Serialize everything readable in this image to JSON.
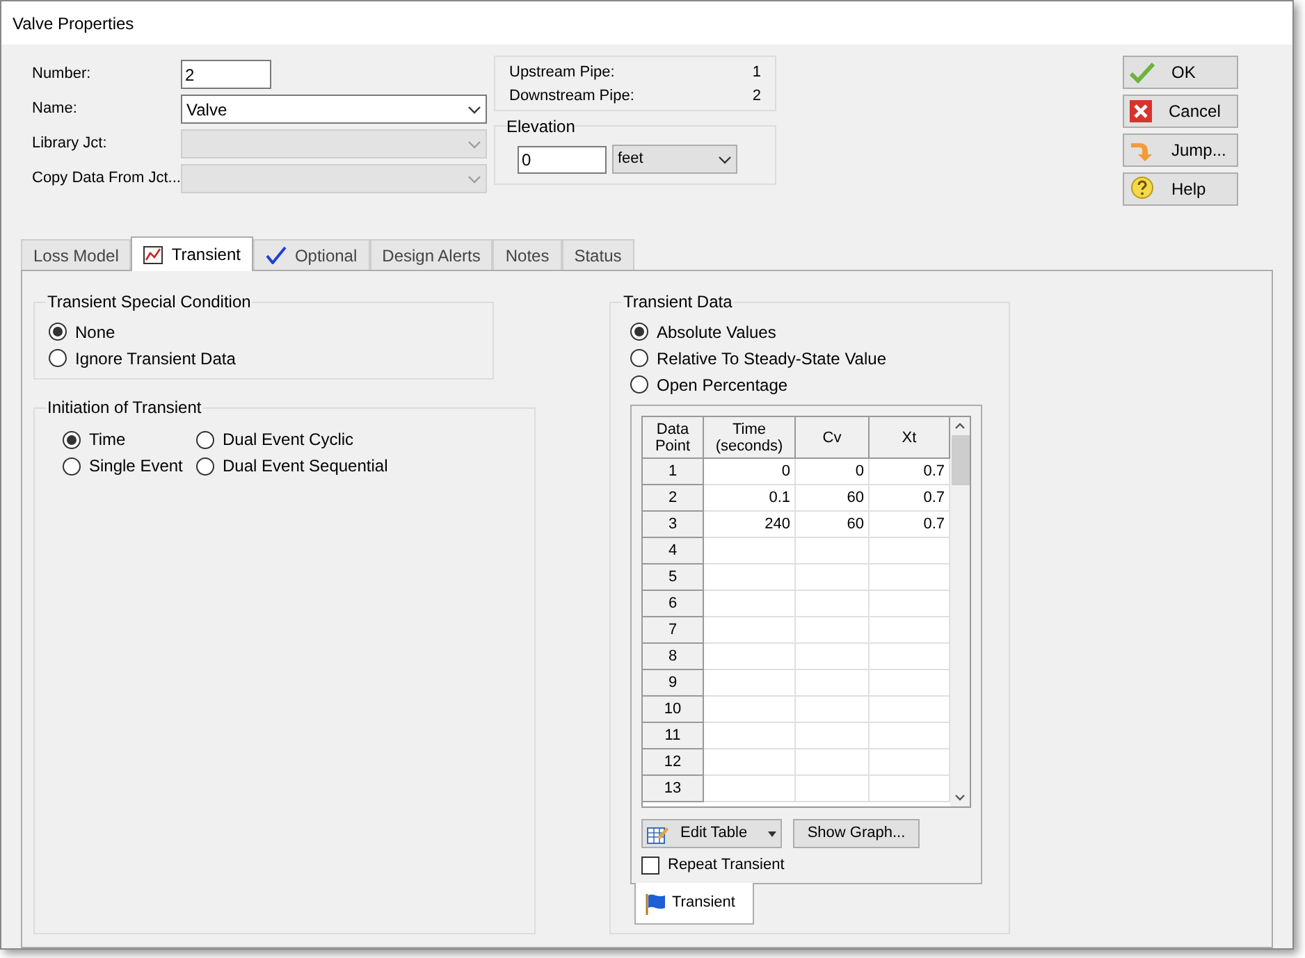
{
  "window": {
    "title": "Valve Properties"
  },
  "fields": [
    {
      "kind": "text",
      "label": "Number:",
      "value": "2"
    },
    {
      "kind": "combo",
      "label": "Name:",
      "value": "Valve",
      "disabled": false
    },
    {
      "kind": "combo",
      "label": "Library Jct:",
      "disabled": true
    },
    {
      "kind": "combo",
      "label": "Copy Data From Jct...",
      "disabled": true
    }
  ],
  "pipes": [
    {
      "label": "Upstream Pipe:",
      "value": "1"
    },
    {
      "label": "Downstream Pipe:",
      "value": "2"
    }
  ],
  "elevation": {
    "title": "Elevation",
    "value": "0",
    "unit": "feet"
  },
  "buttons": [
    {
      "kind": "ok",
      "label": "OK"
    },
    {
      "kind": "cancel",
      "label": "Cancel"
    },
    {
      "kind": "jump",
      "label": "Jump..."
    },
    {
      "kind": "help",
      "label": "Help"
    }
  ],
  "tabs": [
    {
      "label": "Loss Model",
      "selected": false
    },
    {
      "label": "Transient",
      "selected": true
    },
    {
      "label": "Optional",
      "selected": false
    },
    {
      "label": "Design Alerts",
      "selected": false
    },
    {
      "label": "Notes",
      "selected": false
    },
    {
      "label": "Status",
      "selected": false
    }
  ],
  "special_condition": {
    "title": "Transient Special Condition",
    "options": [
      {
        "label": "None",
        "selected": true
      },
      {
        "label": "Ignore Transient Data",
        "selected": false
      }
    ]
  },
  "initiation": {
    "title": "Initiation of Transient",
    "options": [
      {
        "label": "Time",
        "selected": true
      },
      {
        "label": "Dual Event Cyclic",
        "selected": false
      },
      {
        "label": "Single Event",
        "selected": false
      },
      {
        "label": "Dual Event Sequential",
        "selected": false
      }
    ]
  },
  "transient_data": {
    "title": "Transient Data",
    "options": [
      {
        "label": "Absolute Values",
        "selected": true
      },
      {
        "label": "Relative To Steady-State Value",
        "selected": false
      },
      {
        "label": "Open Percentage",
        "selected": false
      }
    ],
    "table": {
      "columns": [
        "Data Point",
        "Time (seconds)",
        "Cv",
        "Xt"
      ],
      "rows": [
        [
          "1",
          "0",
          "0",
          "0.7"
        ],
        [
          "2",
          "0.1",
          "60",
          "0.7"
        ],
        [
          "3",
          "240",
          "60",
          "0.7"
        ],
        [
          "4",
          "",
          "",
          ""
        ],
        [
          "5",
          "",
          "",
          ""
        ],
        [
          "6",
          "",
          "",
          ""
        ],
        [
          "7",
          "",
          "",
          ""
        ],
        [
          "8",
          "",
          "",
          ""
        ],
        [
          "9",
          "",
          "",
          ""
        ],
        [
          "10",
          "",
          "",
          ""
        ],
        [
          "11",
          "",
          "",
          ""
        ],
        [
          "12",
          "",
          "",
          ""
        ],
        [
          "13",
          "",
          "",
          ""
        ]
      ]
    },
    "edit_table": "Edit Table",
    "show_graph": "Show Graph...",
    "repeat": {
      "label": "Repeat Transient",
      "checked": false
    },
    "bottom_tab": "Transient"
  }
}
